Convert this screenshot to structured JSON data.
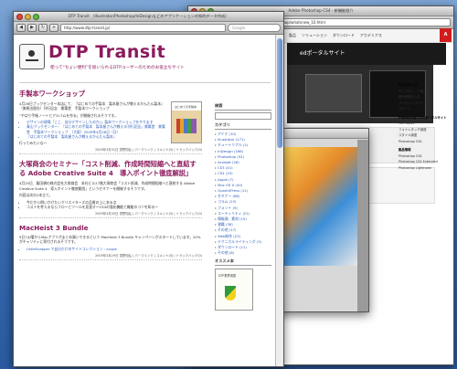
{
  "adobe_window": {
    "title": "Adobe Photoshop CS4 - 新機能紹介",
    "url": "http://www.adobe.com/jp/joc/photoshop/whatsnew_10.html",
    "nav": [
      "製品",
      "ソリューション",
      "ダウンロード",
      "アカデミアス"
    ],
    "banner_text": "edポータルサイト",
    "sidebar": {
      "head1": "次のステップ",
      "items1": [
        "アップグレード購入",
        "販売情報を入手",
        "ライセンスプログラム",
        "サポート"
      ],
      "head2": "Photoshop CS4ポータルサイト",
      "items2": [
        "Hot Topics",
        "フォトレタッチ講座",
        "スタイル講座",
        "Photoshop CS4"
      ],
      "head3": "製品情報",
      "items3": [
        "Photoshop CS4",
        "Photoshop CS4 Extended",
        "Photoshop Lightroom"
      ]
    }
  },
  "dtp_window": {
    "title": "DTP Transit （Illustrator/Photoshop/InDesignなどのアプリケーションの知的データ作成）",
    "url": "http://www.dtp-transit.jp/",
    "search_placeholder": "Google",
    "site_title": "DTP Transit",
    "site_subtitle": "使って“ちょい便利”を扱いられるDTPユーザーのためのお役立ちサイト",
    "posts": [
      {
        "title": "手製本ワークショップ",
        "lines": [
          "4月26日ブックセンター本店にて、『はじめての手製本　製本屋さんが教えるかんたん製本』（美術出版社）刊行記念　美篶堂　手製本ワークショップ",
          "“やはり手帳ノートとアルバムを作る」が開催されるそうです。"
        ],
        "links": [
          "デザインの現場「ここ、自分デザインしたのか」」製本ワークショップをやります",
          "青山ブックセンター：『はじめての手製本　製本屋さんが教える刊行記念」美篶堂　美篶堂　手製本ワークショップ　（大阪）2009年4月26日（日）",
          "『はじめての手製本　製本屋さんが教えるかんたん製本』"
        ],
        "tail": "行ってみたいな〜",
        "book_title": "はじめての手製本",
        "meta": "2009年3月31日 書野知弘 | パーマリンク | コメント(0) | トラックバック(0)"
      },
      {
        "title": "大塚商会のセミナー「コスト削減、作成時間短縮へと直結する Adobe Creative Suite 4　導入ポイント徹底解説」",
        "lines": [
          "4月20日、飯田橋の株式会社大塚商会　本社ビル27階大塚商会「コスト削減、作成時間短縮へと直結する Adobe Creative Suite 4　導入ポイント徹底解説」というセミナーを開催するそうです。",
          "内容は次の2本立て。",
          "今だから問いかけたいクリエイターズの品質の上にある点",
          "コストを考えるならフローとツールを見直す〜CS4の強化機能と機能のコツを知る〜"
        ],
        "links": [],
        "tail": "",
        "book_title": "",
        "meta": "2009年3月30日 書野知弘 | パーマリンク | コメント(0) | トラックバック(0)"
      },
      {
        "title": "MacHeist 3 Bundle",
        "lines": [
          "9日7火曜からMacアプリがまとめ買いできるという MacHeist 3 Bundle キャンペーンがスタートしています。20%がチャリティに寄付されるそうです。"
        ],
        "links": [
          "LittleSnapper で自分だけのサイトコレクション : coupe"
        ],
        "tail": "",
        "book_title": "",
        "meta": "2009年3月29日 書野知弘 | パーマリンク | コメント(0) | トラックバック(0)"
      }
    ],
    "sidebar": {
      "search_head": "検索",
      "category_head": "カテゴリ",
      "categories": [
        "アイデ (10)",
        "Illustrator (171)",
        "チュートリアル (2)",
        "InDesign (166)",
        "Photoshop (52)",
        "Acrobat (26)",
        "CS3 (41)",
        "CS4 (25)",
        "Apple (7)",
        "Mac OS X (40)",
        "QuarkXPress (11)",
        "セミナー (68)",
        "コラム (13)",
        "フォント (9)",
        "ユーティリティ (21)",
        "情報源、素材 (15)",
        "書籍 (38)",
        "その他 (17)",
        "Web制作 (23)",
        "テクニカルライティング (3)",
        "ダウンロード (11)",
        "その他 (8)"
      ],
      "ad_head": "オススメ本",
      "ad_book_title": "DTP業界用語"
    }
  }
}
